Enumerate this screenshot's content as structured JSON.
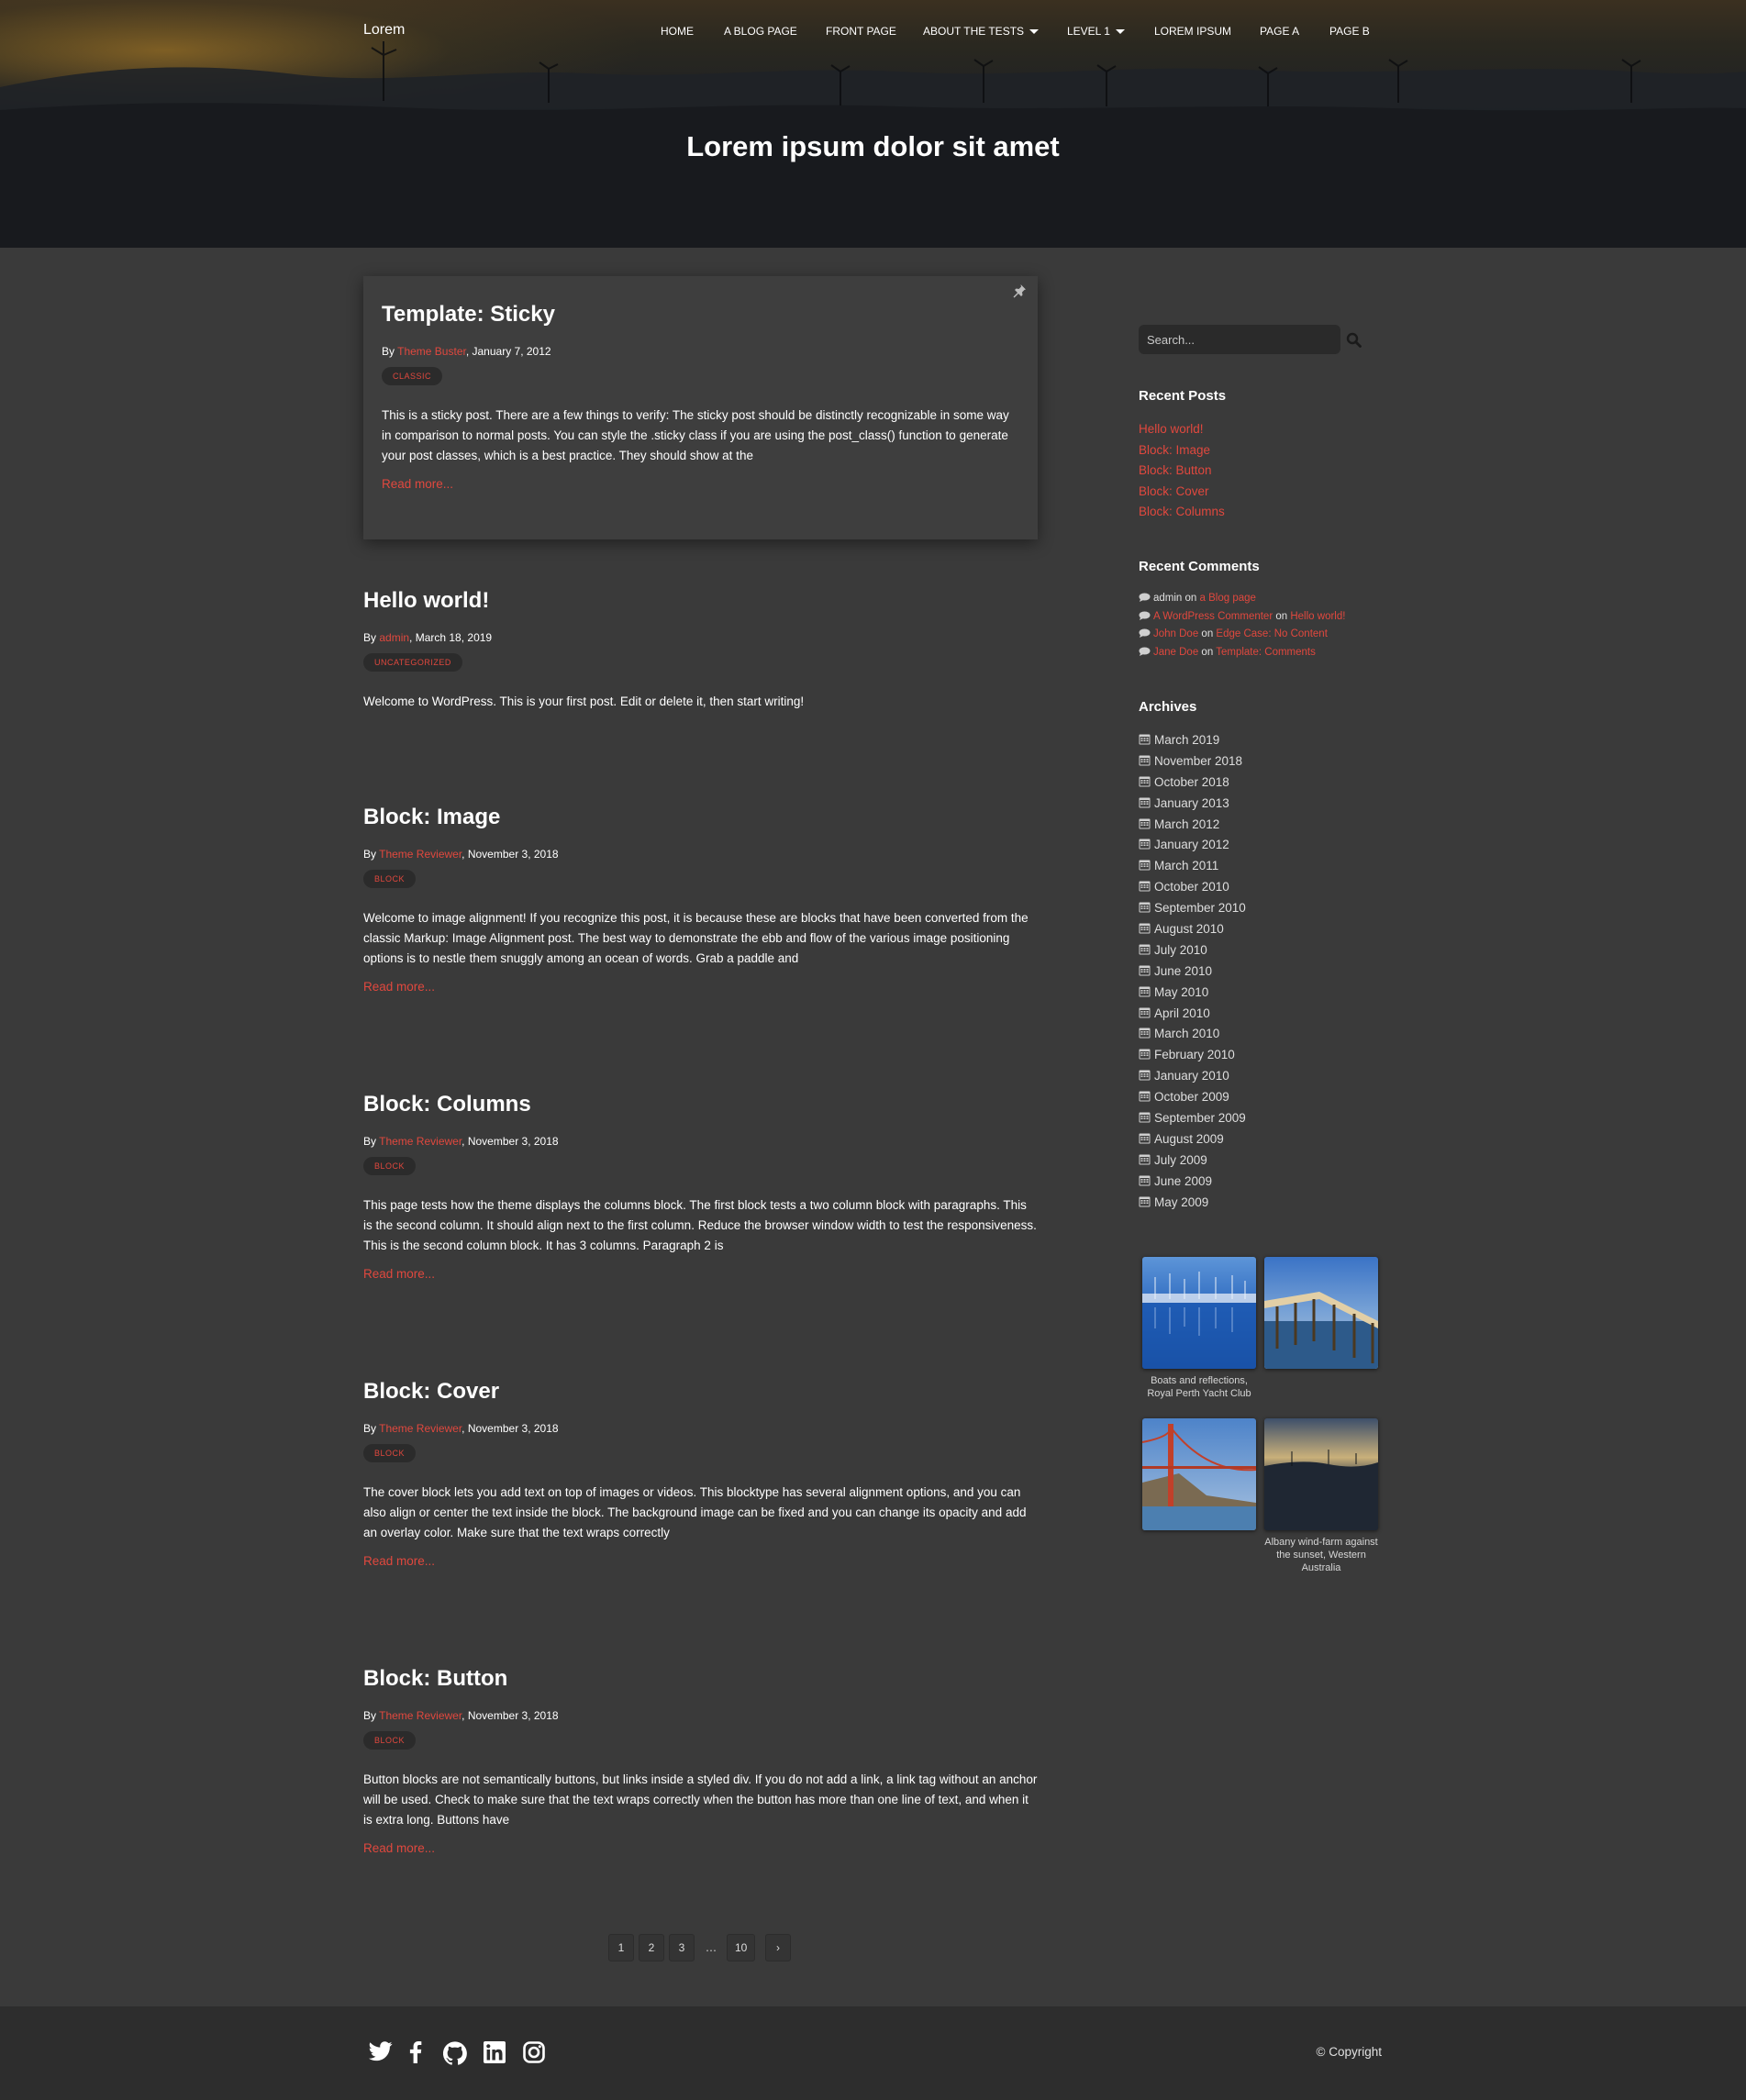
{
  "header": {
    "site_title": "Lorem",
    "hero_title": "Lorem ipsum dolor sit amet",
    "nav": [
      {
        "label": "HOME"
      },
      {
        "label": "A BLOG PAGE"
      },
      {
        "label": "FRONT PAGE"
      },
      {
        "label": "ABOUT THE TESTS",
        "has_dropdown": true
      },
      {
        "label": "LEVEL 1",
        "has_dropdown": true
      },
      {
        "label": "LOREM IPSUM"
      },
      {
        "label": "PAGE A"
      },
      {
        "label": "PAGE B"
      }
    ]
  },
  "posts": [
    {
      "title": "Template: Sticky",
      "by": "By ",
      "author": "Theme Buster",
      "date": ", January 7, 2012",
      "category": "CLASSIC",
      "excerpt": "This is a sticky post. There are a few things to verify: The sticky post should be distinctly recognizable in some way in comparison to normal posts. You can style the .sticky class if you are using the post_class() function to generate your post classes, which is a best practice. They should show at the",
      "read_more": "Read more...",
      "sticky": true
    },
    {
      "title": "Hello world!",
      "by": "By ",
      "author": "admin",
      "date": ", March 18, 2019",
      "category": "UNCATEGORIZED",
      "excerpt": "Welcome to WordPress. This is your first post. Edit or delete it, then start writing!",
      "read_more": ""
    },
    {
      "title": "Block: Image",
      "by": "By ",
      "author": "Theme Reviewer",
      "date": ", November 3, 2018",
      "category": "BLOCK",
      "excerpt": "Welcome to image alignment! If you recognize this post, it is because these are blocks that have been converted from the classic Markup: Image Alignment post. The best way to demonstrate the ebb and flow of the various image positioning options is to nestle them snuggly among an ocean of words. Grab a paddle and",
      "read_more": "Read more..."
    },
    {
      "title": "Block: Columns",
      "by": "By ",
      "author": "Theme Reviewer",
      "date": ", November 3, 2018",
      "category": "BLOCK",
      "excerpt": "This page tests how the theme displays the columns block. The first block tests a two column block with paragraphs. This is the second column. It should align next to the first column. Reduce the browser window width to test the responsiveness. This is the second column block. It has 3 columns. Paragraph 2 is",
      "read_more": "Read more..."
    },
    {
      "title": "Block: Cover",
      "by": "By ",
      "author": "Theme Reviewer",
      "date": ", November 3, 2018",
      "category": "BLOCK",
      "excerpt": "The cover block lets you add text on top of images or videos. This blocktype has several alignment options, and you can also align or center the text inside the block. The background image can be fixed and you can change its opacity and add an overlay color. Make sure that the text wraps correctly",
      "read_more": "Read more..."
    },
    {
      "title": "Block: Button",
      "by": "By ",
      "author": "Theme Reviewer",
      "date": ", November 3, 2018",
      "category": "BLOCK",
      "excerpt": "Button blocks are not semantically buttons, but links inside a styled div.  If you do not add a link, a link tag without an anchor will be used. Check to make sure that the text wraps correctly when the button has more than one line of text, and when it is extra long. Buttons have",
      "read_more": "Read more..."
    }
  ],
  "pagination": {
    "pages": [
      "1",
      "2",
      "3"
    ],
    "ellipsis": "…",
    "last": "10",
    "next": "›"
  },
  "sidebar": {
    "search_placeholder": "Search...",
    "search_icon": "search-icon",
    "recent_posts_title": "Recent Posts",
    "recent_posts": [
      "Hello world!",
      "Block: Image",
      "Block: Button",
      "Block: Cover",
      "Block: Columns"
    ],
    "recent_comments_title": "Recent Comments",
    "recent_comments": [
      {
        "author": "admin",
        "author_is_link": false,
        "on": " on ",
        "post": "a Blog page"
      },
      {
        "author": "A WordPress Commenter",
        "author_is_link": true,
        "on": " on ",
        "post": "Hello world!"
      },
      {
        "author": "John Doe",
        "author_is_link": true,
        "on": " on ",
        "post": "Edge Case: No Content"
      },
      {
        "author": "Jane Doe",
        "author_is_link": true,
        "on": " on ",
        "post": "Template: Comments"
      }
    ],
    "archives_title": "Archives",
    "archives": [
      "March 2019",
      "November 2018",
      "October 2018",
      "January 2013",
      "March 2012",
      "January 2012",
      "March 2011",
      "October 2010",
      "September 2010",
      "August 2010",
      "July 2010",
      "June 2010",
      "May 2010",
      "April 2010",
      "March 2010",
      "February 2010",
      "January 2010",
      "October 2009",
      "September 2009",
      "August 2009",
      "July 2009",
      "June 2009",
      "May 2009"
    ],
    "gallery_captions": [
      "Boats and reflections, Royal Perth Yacht Club",
      "Albany wind-farm against the sunset, Western Australia"
    ]
  },
  "footer": {
    "social_icons": [
      "twitter-icon",
      "facebook-icon",
      "github-icon",
      "linkedin-icon",
      "instagram-icon"
    ],
    "copyright": "© Copyright"
  },
  "colors": {
    "accent": "#e0483e",
    "background": "#3a3a3a",
    "footer": "#2d2d2d"
  }
}
